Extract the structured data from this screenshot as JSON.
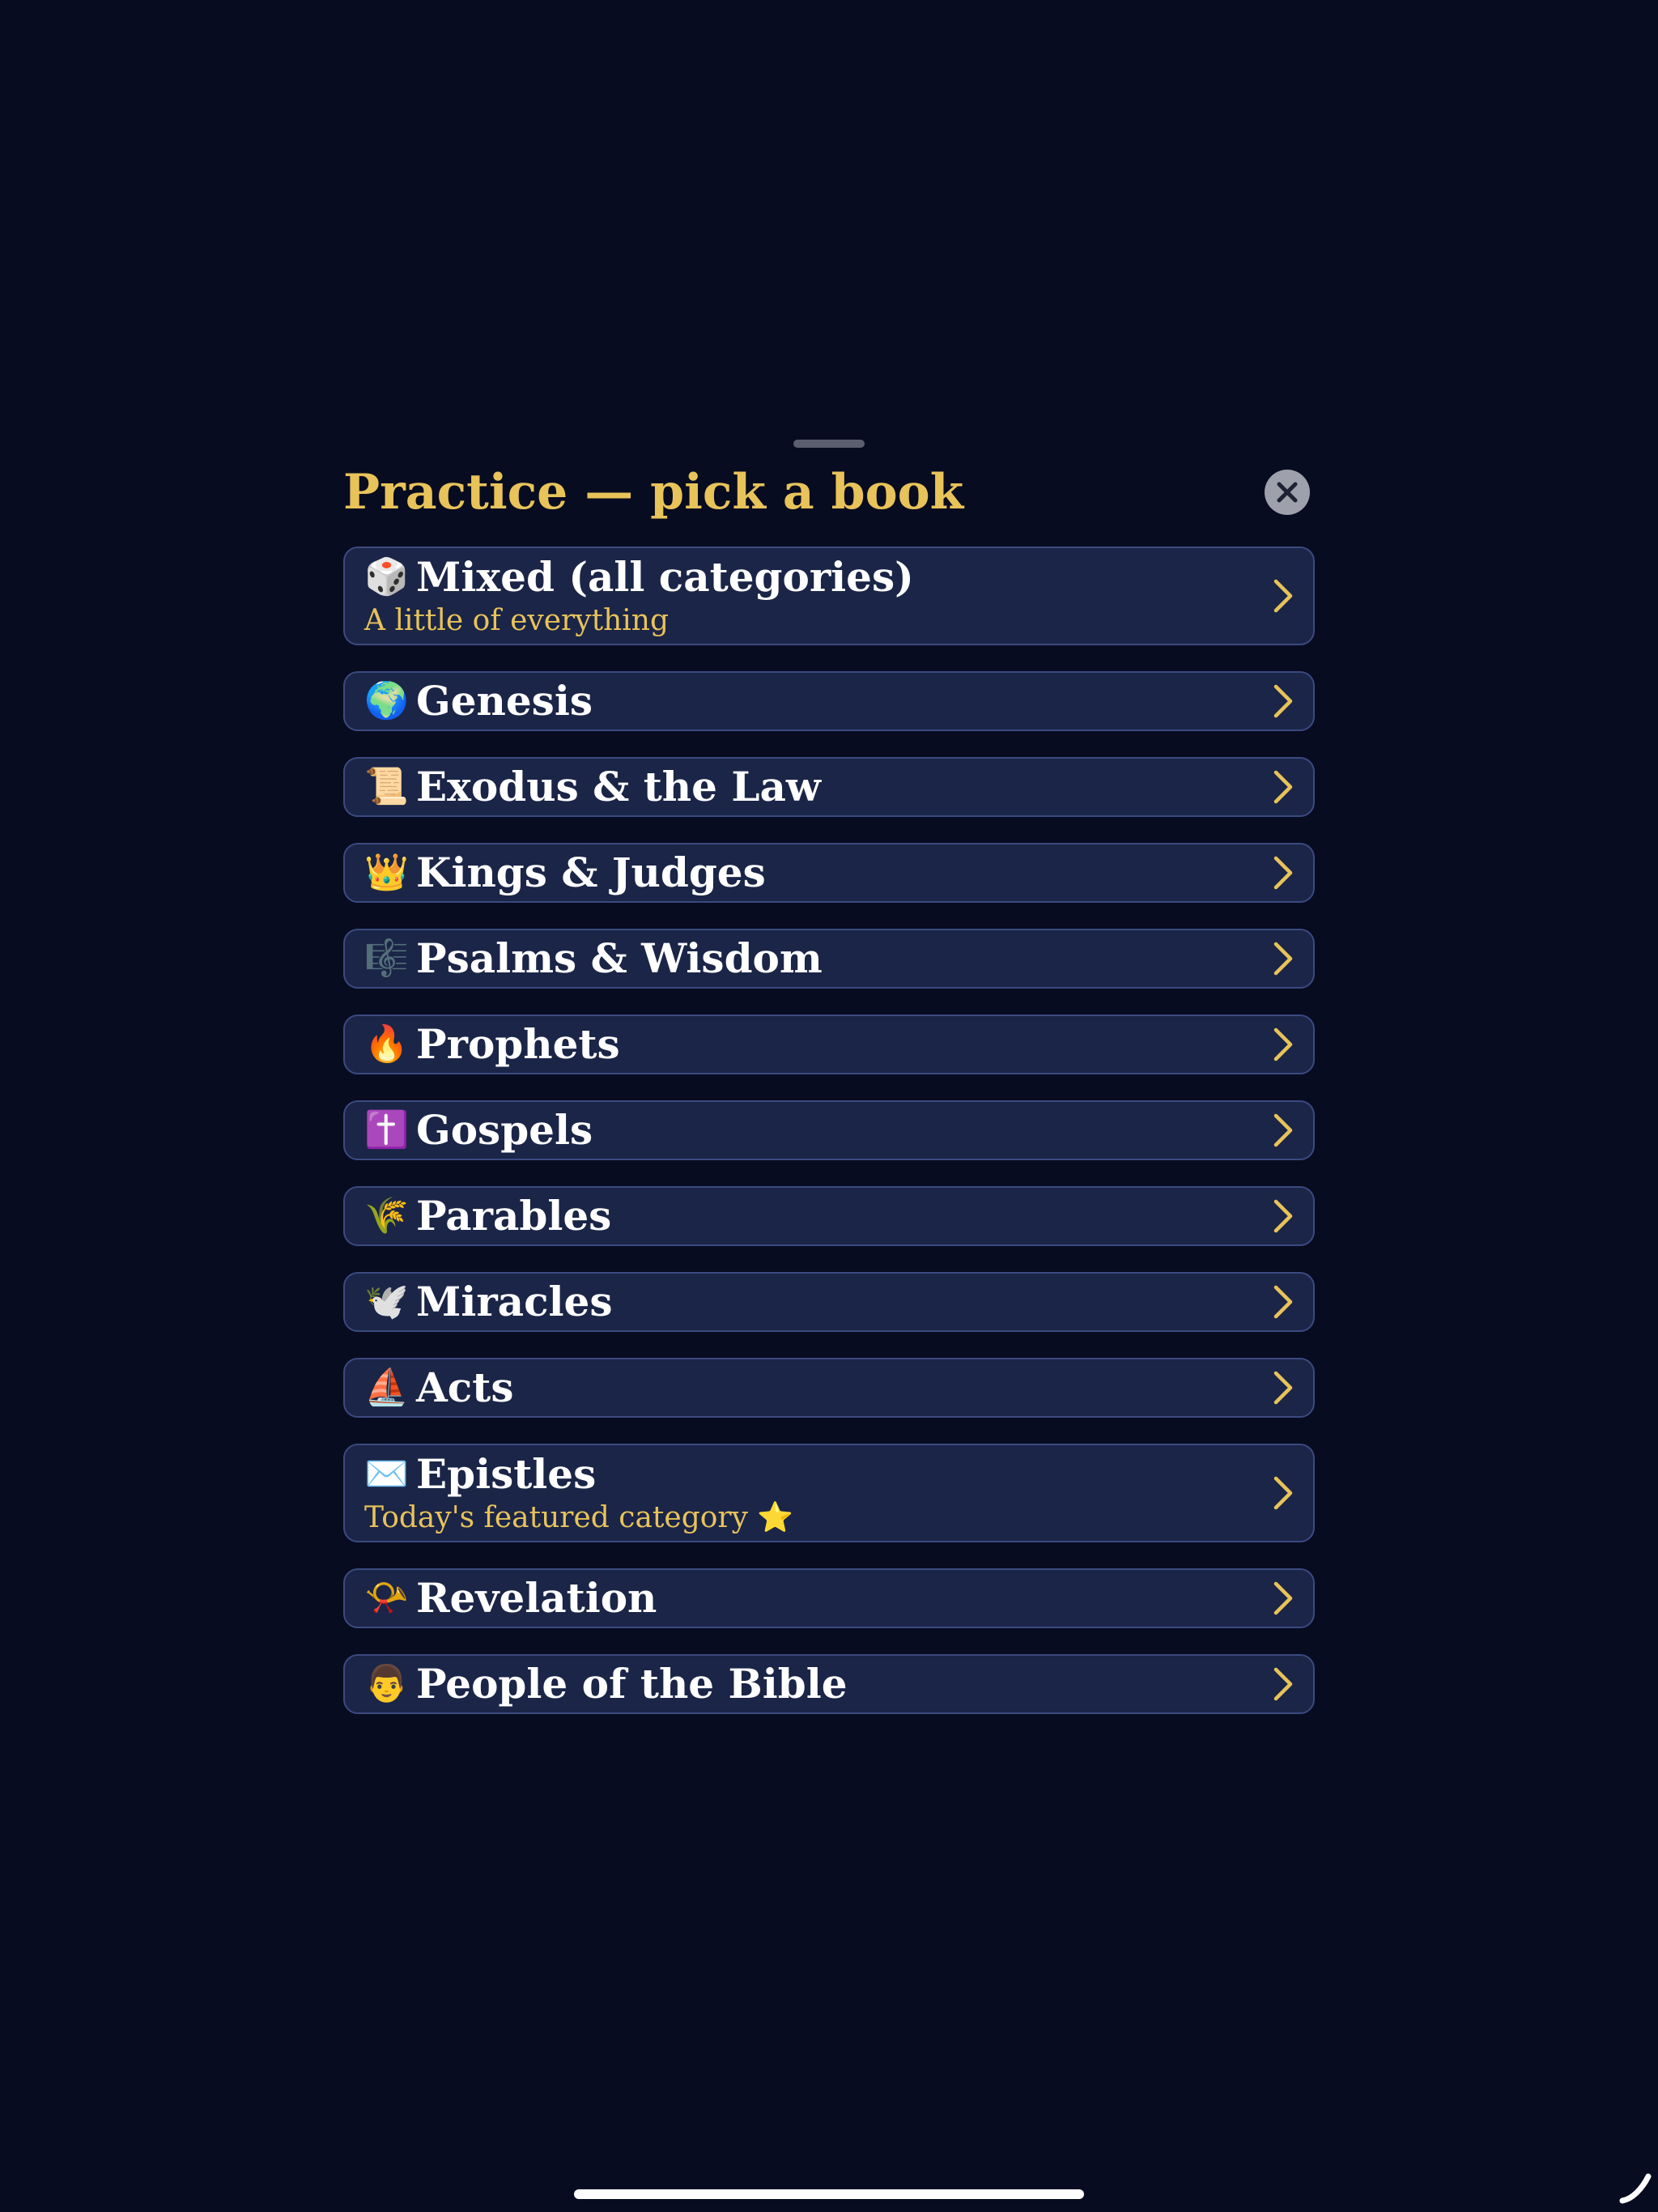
{
  "sheet": {
    "title": "Practice — pick a book"
  },
  "colors": {
    "background": "#080c20",
    "row_fill": "#1b2547",
    "row_border": "#3b4a80",
    "accent_gold": "#e8c35a",
    "close_fill": "#9ea1ab"
  },
  "books": [
    {
      "emoji": "🎲",
      "icon": "die-icon",
      "label": "Mixed (all categories)",
      "subtitle": "A little of everything"
    },
    {
      "emoji": "🌍",
      "icon": "globe-icon",
      "label": "Genesis"
    },
    {
      "emoji": "📜",
      "icon": "scroll-icon",
      "label": "Exodus & the Law"
    },
    {
      "emoji": "👑",
      "icon": "crown-icon",
      "label": "Kings & Judges"
    },
    {
      "emoji": "🎼",
      "icon": "music-score-icon",
      "label": "Psalms & Wisdom"
    },
    {
      "emoji": "🔥",
      "icon": "fire-icon",
      "label": "Prophets"
    },
    {
      "emoji": "✝️",
      "icon": "cross-icon",
      "label": "Gospels"
    },
    {
      "emoji": "🌾",
      "icon": "wheat-icon",
      "label": "Parables"
    },
    {
      "emoji": "🕊️",
      "icon": "dove-icon",
      "label": "Miracles"
    },
    {
      "emoji": "⛵",
      "icon": "sailboat-icon",
      "label": "Acts"
    },
    {
      "emoji": "✉️",
      "icon": "envelope-icon",
      "label": "Epistles",
      "subtitle": "Today's featured category ⭐"
    },
    {
      "emoji": "📯",
      "icon": "horn-icon",
      "label": "Revelation"
    },
    {
      "emoji": "👨",
      "icon": "person-icon",
      "label": "People of the Bible"
    }
  ]
}
